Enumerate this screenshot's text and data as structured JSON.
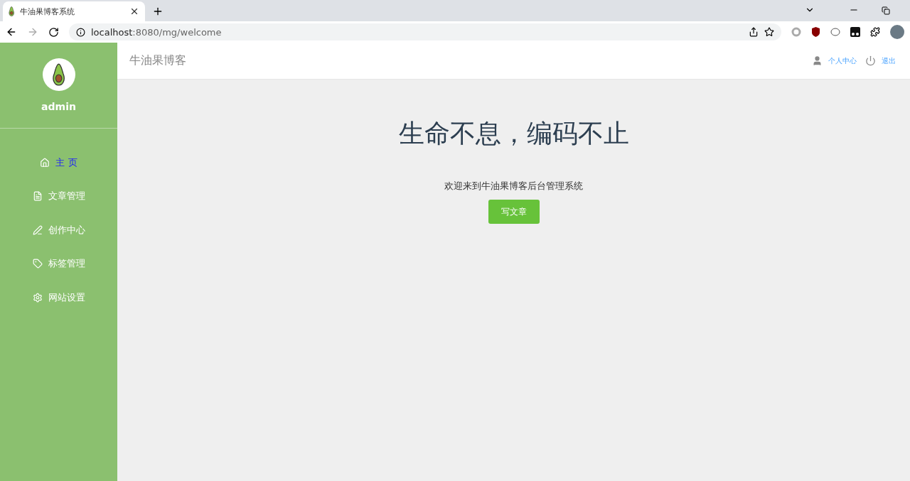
{
  "browser": {
    "tab_title": "牛油果博客系统",
    "url_host": "localhost",
    "url_path": ":8080/mg/welcome"
  },
  "sidebar": {
    "username": "admin",
    "items": [
      {
        "kind": "home",
        "label": "主 页",
        "selected": true
      },
      {
        "kind": "articles",
        "label": "文章管理",
        "selected": false
      },
      {
        "kind": "write",
        "label": "创作中心",
        "selected": false
      },
      {
        "kind": "tags",
        "label": "标签管理",
        "selected": false
      },
      {
        "kind": "settings",
        "label": "网站设置",
        "selected": false
      }
    ]
  },
  "header": {
    "title": "牛油果博客",
    "links": [
      {
        "kind": "user",
        "label": "个人中心"
      },
      {
        "kind": "logout",
        "label": "退出"
      }
    ]
  },
  "main": {
    "headline": "生命不息，编码不止",
    "subtitle": "欢迎来到牛油果博客后台管理系统",
    "button": "写文章"
  }
}
